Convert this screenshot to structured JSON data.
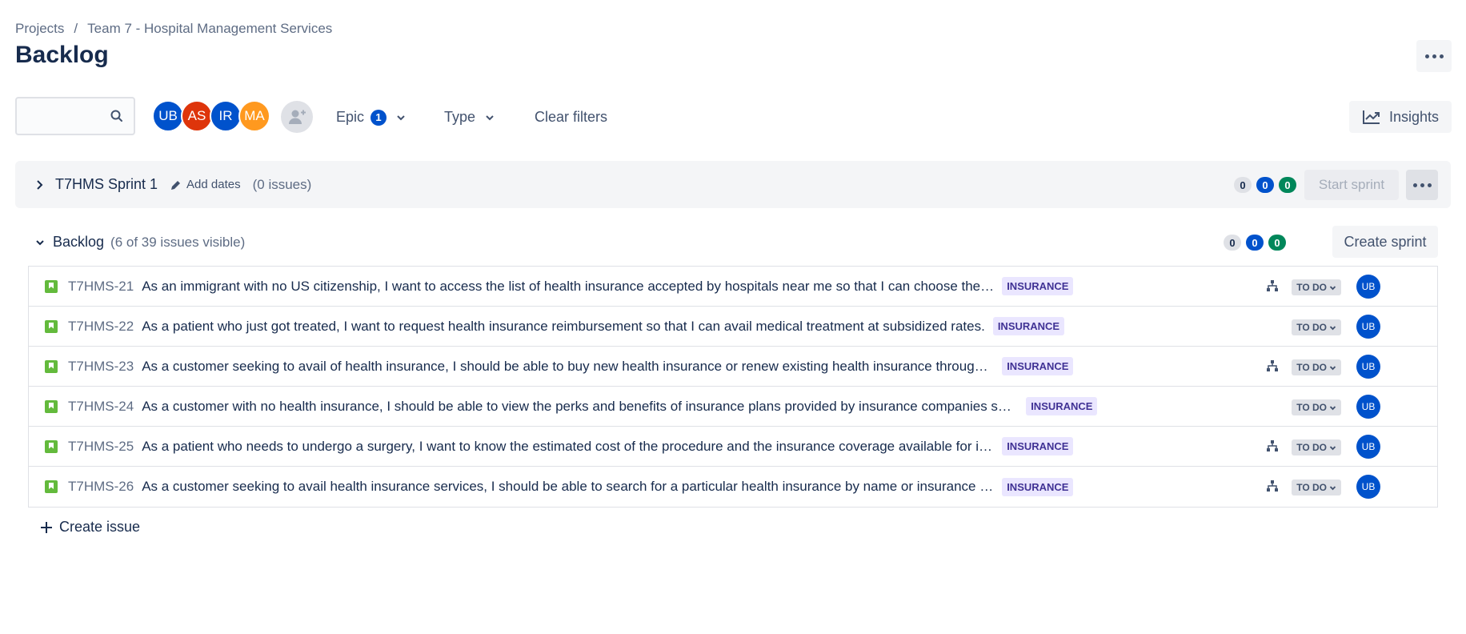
{
  "breadcrumb": {
    "items": [
      "Projects",
      "Team 7 - Hospital Management Services"
    ],
    "separator": "/"
  },
  "page": {
    "title": "Backlog"
  },
  "toolbar": {
    "search_placeholder": "",
    "avatars": [
      {
        "initials": "UB",
        "color": "#0052cc"
      },
      {
        "initials": "AS",
        "color": "#de350b"
      },
      {
        "initials": "IR",
        "color": "#0052cc"
      },
      {
        "initials": "MA",
        "color": "#ff991f"
      }
    ],
    "epic_label": "Epic",
    "epic_count": "1",
    "type_label": "Type",
    "clear_filters": "Clear filters",
    "insights_label": "Insights"
  },
  "sprint": {
    "name": "T7HMS Sprint 1",
    "add_dates": "Add dates",
    "issue_count": "(0 issues)",
    "counts": {
      "todo": "0",
      "in_progress": "0",
      "done": "0"
    },
    "start_label": "Start sprint"
  },
  "backlog": {
    "name": "Backlog",
    "visible_text": "(6 of 39 issues visible)",
    "counts": {
      "todo": "0",
      "in_progress": "0",
      "done": "0"
    },
    "create_sprint_label": "Create sprint",
    "create_issue_label": "Create issue",
    "issues": [
      {
        "key": "T7HMS-21",
        "summary": "As an immigrant with no US citizenship, I want to access the list of health insurance accepted by hospitals near me so that I can choose the hospital that accepts ...",
        "label": "INSURANCE",
        "status": "TO DO",
        "assignee": "UB",
        "has_children": true
      },
      {
        "key": "T7HMS-22",
        "summary": "As a patient who just got treated, I want to request health insurance reimbursement so that I can avail medical treatment at subsidized rates.",
        "label": "INSURANCE",
        "status": "TO DO",
        "assignee": "UB",
        "has_children": false
      },
      {
        "key": "T7HMS-23",
        "summary": "As a customer seeking to avail of health insurance, I should be able to buy new health insurance or renew existing health insurance through the app so that I need...",
        "label": "INSURANCE",
        "status": "TO DO",
        "assignee": "UB",
        "has_children": true
      },
      {
        "key": "T7HMS-24",
        "summary": "As a customer with no health insurance, I should be able to view the perks and benefits of insurance plans provided by insurance companies so that I can avail health i...",
        "label": "INSURANCE",
        "status": "TO DO",
        "assignee": "UB",
        "has_children": false
      },
      {
        "key": "T7HMS-25",
        "summary": "As a patient who needs to undergo a surgery, I want to know the estimated cost of the procedure and the insurance coverage available for it so that I can make in...",
        "label": "INSURANCE",
        "status": "TO DO",
        "assignee": "UB",
        "has_children": true
      },
      {
        "key": "T7HMS-26",
        "summary": "As a customer seeking to avail health insurance services, I should be able to search for a particular health insurance by name or insurance provider in the search e...",
        "label": "INSURANCE",
        "status": "TO DO",
        "assignee": "UB",
        "has_children": true
      }
    ]
  }
}
